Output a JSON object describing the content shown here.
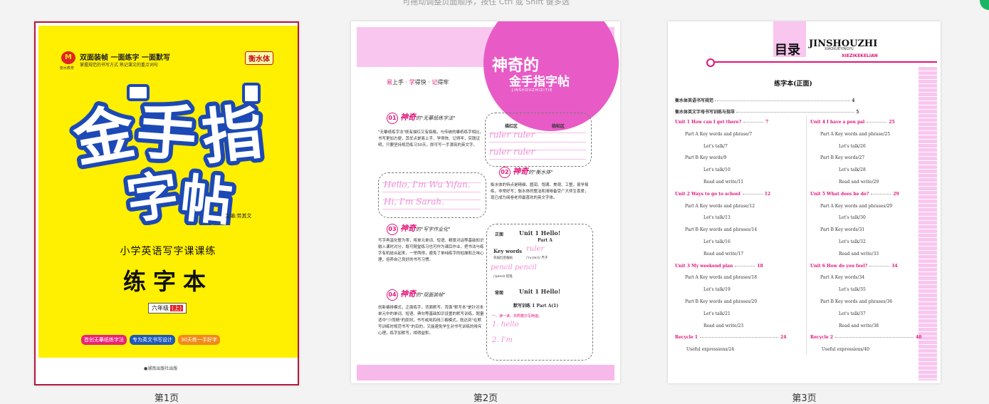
{
  "hint": "可拖动调整页面顺序，按住 Ctrl 或 Shift 键多选",
  "pages": [
    {
      "label": "第1页",
      "cover": {
        "brand_logo": "M",
        "brand_sub": "衡水教育",
        "tagline1": "双面装帧  一面练字  一面默写",
        "tagline2": "掌握规范的书写方式  熟记课文的重点词句",
        "badge": "衡水体",
        "title_chars": [
          "金",
          "手",
          "指",
          "字",
          "帖"
        ],
        "editor": "主编:劳其文",
        "subject": "小学英语写字课课练",
        "book": "练字本",
        "grade": "六年级",
        "grade_term": "(上)",
        "pills": [
          {
            "text": "首创无摹纸练字法",
            "color": "#e8237a"
          },
          {
            "text": "专为英文书写设计",
            "color": "#1d58b8"
          },
          {
            "text": "30天练一手好字",
            "color": "#f08a1a"
          }
        ],
        "publisher": "●湖南出版社出版"
      }
    },
    {
      "label": "第2页",
      "brand": {
        "line1": "神奇的",
        "line2": "金手指字帖",
        "line3": "JINSHOUZHIZITIE"
      },
      "slogan": {
        "a": "易",
        "b": "上手 · ",
        "c": "学",
        "d": "得快 · ",
        "e": "记",
        "f": "得牢"
      },
      "sections": [
        {
          "num": "01",
          "title": "神奇",
          "sub": "的\"无摹纸练字法\""
        },
        {
          "num": "02",
          "title": "神奇",
          "sub": "的\"衡水体\""
        },
        {
          "num": "03",
          "title": "神奇",
          "sub": "的\"写字作业化\""
        },
        {
          "num": "04",
          "title": "神奇",
          "sub": "的\"双面装帧\""
        }
      ],
      "paras": [
        "\"无摹纸练字法\"既有描红又有临格，与传统的摹纸练字相比，书写更加方便，其优点是易上手、学得快、记得牢，实践证明，只要坚持规范练习30天，即可写一手漂亮的英文字。",
        "衡水体的特点是精细、圆润、饱满、美观、工整，易学易练，非常好写；衡水体的整洁和清晰备受广大师生喜爱，现已成为阅卷老师最喜欢的英文字体。",
        "写字再温化整为零，将单元单词、短语、精景对话等基础知识融入课时对分，既可随堂练习也可作为课后作业，把书法与练字有机结合起来，一举两得，避免了单纯练字的枯燥和乏味心理，培养自己良好的书写习惯。",
        "创新编排模式，正面练字，背面默写。背面\"默写本\"是针对本单元中的单词、短语、典句等基础知识设置的默写训练，题量适中\"少而精\"的原则，书写或用四线三格模式，既达到\"在默写训练时规范书写\"的目的，又能避免学生对书写训练的排斥心理，练字加默写，相得益彰。"
      ],
      "practice": {
        "col1": "描红区",
        "col2": "临帖区",
        "ruler1": "ruler  ruler",
        "ruler2": "ruler  ruler",
        "hello": "Hello, I'm Wu Yifan.",
        "hi": "Hi, I'm Sarah.",
        "front": "正面",
        "unit": "Unit 1    Hello!",
        "part": "Part A",
        "kw": "Key words",
        "kw_sub": "先描红后临帖",
        "ruler3": "ruler",
        "phon1": "/ˈruːlə(r)/ 尺子",
        "pencil": "pencil   pencil",
        "phon2": "/ˈpensl/ 铅笔",
        "back": "背面",
        "unit2": "Unit 1    Hello!",
        "drill": "默写训练 1   Part A(1)",
        "task": "一、读一读，并照着抄写两遍。",
        "h1": "1.  hello",
        "h2": "2.  I'm"
      }
    },
    {
      "label": "第3页",
      "toc": {
        "title": "目录",
        "brand1": "JINSHOUZHI",
        "brand2": "XIAOXUEYINGYU",
        "brand3": "XIEZIKEKELIAN",
        "subtitle": "练字本(正面)",
        "head1": {
          "text": "衡水体英语书写规范",
          "page": "4"
        },
        "head2": {
          "text": "衡水体英文字母书写训练与指导",
          "page": "5"
        },
        "left": [
          {
            "kind": "unit",
            "text": "Unit 1   How can I get there?",
            "page": "7"
          },
          {
            "kind": "item",
            "text": "Part A   Key words and phrase/7"
          },
          {
            "kind": "sub",
            "text": "Let's talk/7"
          },
          {
            "kind": "item",
            "text": "Part B   Key words/9"
          },
          {
            "kind": "sub",
            "text": "Let's talk/10"
          },
          {
            "kind": "sub",
            "text": "Read and write/11"
          },
          {
            "kind": "unit",
            "text": "Unit 2   Ways to go to school",
            "page": "12"
          },
          {
            "kind": "item",
            "text": "Part A   Key words and phrase/12"
          },
          {
            "kind": "sub",
            "text": "Let's talk/13"
          },
          {
            "kind": "item",
            "text": "Part B   Key words and phrases/14"
          },
          {
            "kind": "sub",
            "text": "Let's talk/16"
          },
          {
            "kind": "sub",
            "text": "Read and write/17"
          },
          {
            "kind": "unit",
            "text": "Unit 3   My weekend plan",
            "page": "18"
          },
          {
            "kind": "item",
            "text": "Part A   Key words and phrases/18"
          },
          {
            "kind": "sub",
            "text": "Let's talk/19"
          },
          {
            "kind": "item",
            "text": "Part B   Key words and phrases/20"
          },
          {
            "kind": "sub",
            "text": "Let's talk/21"
          },
          {
            "kind": "sub",
            "text": "Read and write/23"
          },
          {
            "kind": "unit",
            "text": "Recycle 1",
            "page": "24"
          },
          {
            "kind": "plain",
            "text": "Useful expressions/24"
          }
        ],
        "right": [
          {
            "kind": "unit",
            "text": "Unit 4   I have a pen pal",
            "page": "25"
          },
          {
            "kind": "item",
            "text": "Part A   Key words and phrase/25"
          },
          {
            "kind": "sub",
            "text": "Let's talk/26"
          },
          {
            "kind": "item",
            "text": "Part B   Key words/27"
          },
          {
            "kind": "sub",
            "text": "Let's talk/28"
          },
          {
            "kind": "sub",
            "text": "Read and write/29"
          },
          {
            "kind": "unit",
            "text": "Unit 5   What does he do?",
            "page": "29"
          },
          {
            "kind": "item",
            "text": "Part A   Key words and phrases/29"
          },
          {
            "kind": "sub",
            "text": "Let's talk/30"
          },
          {
            "kind": "item",
            "text": "Part B   Key words/31"
          },
          {
            "kind": "sub",
            "text": "Let's talk/32"
          },
          {
            "kind": "sub",
            "text": "Read and write/33"
          },
          {
            "kind": "unit",
            "text": "Unit 6   How do you feel?",
            "page": "34"
          },
          {
            "kind": "item",
            "text": "Part A   Key words/34"
          },
          {
            "kind": "sub",
            "text": "Let's talk/35"
          },
          {
            "kind": "item",
            "text": "Part B   Key words and phrases/36"
          },
          {
            "kind": "sub",
            "text": "Let's talk/37"
          },
          {
            "kind": "sub",
            "text": "Read and write/38"
          },
          {
            "kind": "unit",
            "text": "Recycle 2",
            "page": "40"
          },
          {
            "kind": "plain",
            "text": "Useful expressions/40"
          }
        ]
      }
    }
  ],
  "colors": {
    "accent": "#e0167a",
    "selected_border": "#b3173f",
    "cover_yellow": "#ffef00",
    "fab": "#18b566"
  }
}
